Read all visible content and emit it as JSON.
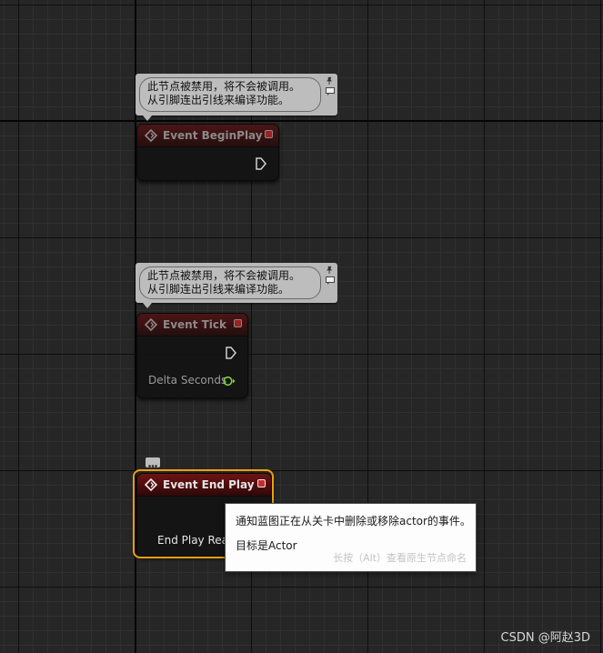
{
  "nodes": [
    {
      "title": "Event BeginPlay",
      "comment_line1": "此节点被禁用，将不会被调用。",
      "comment_line2": "从引脚连出引线来编译功能。"
    },
    {
      "title": "Event Tick",
      "comment_line1": "此节点被禁用，将不会被调用。",
      "comment_line2": "从引脚连出引线来编译功能。",
      "pin_label": "Delta Seconds"
    },
    {
      "title": "Event End Play",
      "pin_label": "End Play Reas"
    }
  ],
  "tooltip": {
    "description": "通知蓝图正在从关卡中删除或移除actor的事件。",
    "target": "目标是Actor",
    "hint": "长按（Alt）查看原生节点命名"
  },
  "watermark": "CSDN @阿赵3D",
  "colors": {
    "event_header": "#6c1414",
    "selection": "#e8a10c",
    "delegate_pin": "#c72b2b",
    "float_pin": "#7bd33a"
  },
  "icons": {
    "event": "event-diamond-icon",
    "pin": "pin-icon",
    "comment": "comment-bubble-icon",
    "exec": "exec-pin-icon",
    "float": "float-pin-icon"
  }
}
